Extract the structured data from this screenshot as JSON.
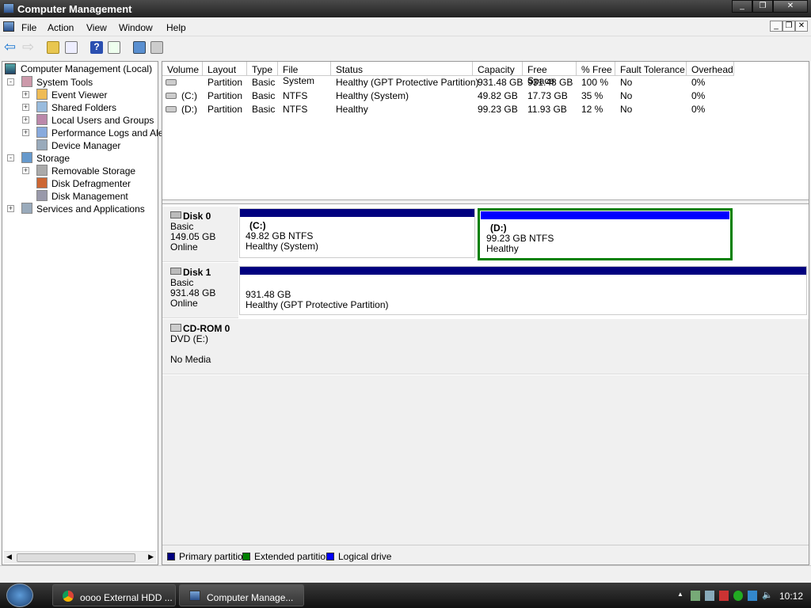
{
  "window": {
    "title": "Computer Management"
  },
  "menu": [
    "File",
    "Action",
    "View",
    "Window",
    "Help"
  ],
  "toolbar": [
    "back-icon",
    "forward-icon",
    "up-folder-icon",
    "show-hide-tree-icon",
    "help-icon",
    "show-hide-action-pane-icon",
    "refresh-icon",
    "properties-icon"
  ],
  "tree": {
    "root": "Computer Management (Local)",
    "items": [
      {
        "label": "System Tools",
        "level": 1,
        "expander": "-"
      },
      {
        "label": "Event Viewer",
        "level": 2,
        "expander": "+"
      },
      {
        "label": "Shared Folders",
        "level": 2,
        "expander": "+"
      },
      {
        "label": "Local Users and Groups",
        "level": 2,
        "expander": "+"
      },
      {
        "label": "Performance Logs and Ale",
        "level": 2,
        "expander": "+"
      },
      {
        "label": "Device Manager",
        "level": 2,
        "expander": ""
      },
      {
        "label": "Storage",
        "level": 1,
        "expander": "-"
      },
      {
        "label": "Removable Storage",
        "level": 2,
        "expander": "+"
      },
      {
        "label": "Disk Defragmenter",
        "level": 2,
        "expander": ""
      },
      {
        "label": "Disk Management",
        "level": 2,
        "expander": ""
      },
      {
        "label": "Services and Applications",
        "level": 1,
        "expander": "+"
      }
    ]
  },
  "volumes": {
    "columns": [
      "Volume",
      "Layout",
      "Type",
      "File System",
      "Status",
      "Capacity",
      "Free Space",
      "% Free",
      "Fault Tolerance",
      "Overhead"
    ],
    "rows": [
      [
        "",
        "Partition",
        "Basic",
        "",
        "Healthy (GPT Protective Partition)",
        "931.48 GB",
        "931.48 GB",
        "100 %",
        "No",
        "0%"
      ],
      [
        "(C:)",
        "Partition",
        "Basic",
        "NTFS",
        "Healthy (System)",
        "49.82 GB",
        "17.73 GB",
        "35 %",
        "No",
        "0%"
      ],
      [
        "(D:)",
        "Partition",
        "Basic",
        "NTFS",
        "Healthy",
        "99.23 GB",
        "11.93 GB",
        "12 %",
        "No",
        "0%"
      ]
    ]
  },
  "disks": [
    {
      "name": "Disk 0",
      "type": "Basic",
      "size": "149.05 GB",
      "state": "Online"
    },
    {
      "name": "Disk 1",
      "type": "Basic",
      "size": "931.48 GB",
      "state": "Online"
    },
    {
      "name": "CD-ROM 0",
      "type": "DVD (E:)",
      "size": "",
      "state": "No Media"
    }
  ],
  "partitions": {
    "c": {
      "name": "(C:)",
      "size": "49.82 GB NTFS",
      "status": "Healthy (System)"
    },
    "d": {
      "name": "(D:)",
      "size": "99.23 GB NTFS",
      "status": "Healthy"
    },
    "disk1": {
      "size": "931.48 GB",
      "status": "Healthy (GPT Protective Partition)"
    }
  },
  "legend": [
    {
      "label": "Primary partition",
      "color": "#00007f"
    },
    {
      "label": "Extended partition",
      "color": "#008000"
    },
    {
      "label": "Logical drive",
      "color": "#0000ff"
    }
  ],
  "taskbar": {
    "tasks": [
      "oooo External HDD ...",
      "Computer Manage..."
    ],
    "clock": "10:12"
  }
}
